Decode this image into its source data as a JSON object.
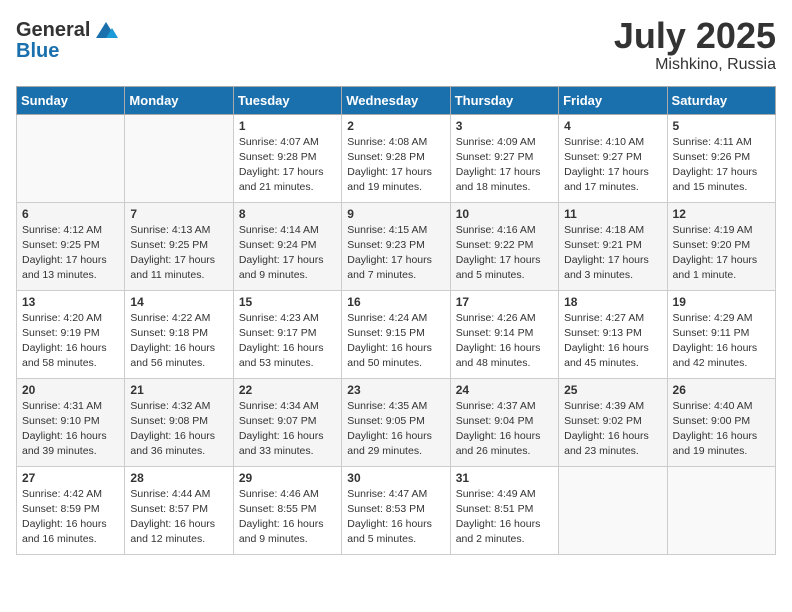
{
  "header": {
    "logo_general": "General",
    "logo_blue": "Blue",
    "month": "July 2025",
    "location": "Mishkino, Russia"
  },
  "columns": [
    "Sunday",
    "Monday",
    "Tuesday",
    "Wednesday",
    "Thursday",
    "Friday",
    "Saturday"
  ],
  "rows": [
    [
      {
        "day": "",
        "info": ""
      },
      {
        "day": "",
        "info": ""
      },
      {
        "day": "1",
        "info": "Sunrise: 4:07 AM\nSunset: 9:28 PM\nDaylight: 17 hours and 21 minutes."
      },
      {
        "day": "2",
        "info": "Sunrise: 4:08 AM\nSunset: 9:28 PM\nDaylight: 17 hours and 19 minutes."
      },
      {
        "day": "3",
        "info": "Sunrise: 4:09 AM\nSunset: 9:27 PM\nDaylight: 17 hours and 18 minutes."
      },
      {
        "day": "4",
        "info": "Sunrise: 4:10 AM\nSunset: 9:27 PM\nDaylight: 17 hours and 17 minutes."
      },
      {
        "day": "5",
        "info": "Sunrise: 4:11 AM\nSunset: 9:26 PM\nDaylight: 17 hours and 15 minutes."
      }
    ],
    [
      {
        "day": "6",
        "info": "Sunrise: 4:12 AM\nSunset: 9:25 PM\nDaylight: 17 hours and 13 minutes."
      },
      {
        "day": "7",
        "info": "Sunrise: 4:13 AM\nSunset: 9:25 PM\nDaylight: 17 hours and 11 minutes."
      },
      {
        "day": "8",
        "info": "Sunrise: 4:14 AM\nSunset: 9:24 PM\nDaylight: 17 hours and 9 minutes."
      },
      {
        "day": "9",
        "info": "Sunrise: 4:15 AM\nSunset: 9:23 PM\nDaylight: 17 hours and 7 minutes."
      },
      {
        "day": "10",
        "info": "Sunrise: 4:16 AM\nSunset: 9:22 PM\nDaylight: 17 hours and 5 minutes."
      },
      {
        "day": "11",
        "info": "Sunrise: 4:18 AM\nSunset: 9:21 PM\nDaylight: 17 hours and 3 minutes."
      },
      {
        "day": "12",
        "info": "Sunrise: 4:19 AM\nSunset: 9:20 PM\nDaylight: 17 hours and 1 minute."
      }
    ],
    [
      {
        "day": "13",
        "info": "Sunrise: 4:20 AM\nSunset: 9:19 PM\nDaylight: 16 hours and 58 minutes."
      },
      {
        "day": "14",
        "info": "Sunrise: 4:22 AM\nSunset: 9:18 PM\nDaylight: 16 hours and 56 minutes."
      },
      {
        "day": "15",
        "info": "Sunrise: 4:23 AM\nSunset: 9:17 PM\nDaylight: 16 hours and 53 minutes."
      },
      {
        "day": "16",
        "info": "Sunrise: 4:24 AM\nSunset: 9:15 PM\nDaylight: 16 hours and 50 minutes."
      },
      {
        "day": "17",
        "info": "Sunrise: 4:26 AM\nSunset: 9:14 PM\nDaylight: 16 hours and 48 minutes."
      },
      {
        "day": "18",
        "info": "Sunrise: 4:27 AM\nSunset: 9:13 PM\nDaylight: 16 hours and 45 minutes."
      },
      {
        "day": "19",
        "info": "Sunrise: 4:29 AM\nSunset: 9:11 PM\nDaylight: 16 hours and 42 minutes."
      }
    ],
    [
      {
        "day": "20",
        "info": "Sunrise: 4:31 AM\nSunset: 9:10 PM\nDaylight: 16 hours and 39 minutes."
      },
      {
        "day": "21",
        "info": "Sunrise: 4:32 AM\nSunset: 9:08 PM\nDaylight: 16 hours and 36 minutes."
      },
      {
        "day": "22",
        "info": "Sunrise: 4:34 AM\nSunset: 9:07 PM\nDaylight: 16 hours and 33 minutes."
      },
      {
        "day": "23",
        "info": "Sunrise: 4:35 AM\nSunset: 9:05 PM\nDaylight: 16 hours and 29 minutes."
      },
      {
        "day": "24",
        "info": "Sunrise: 4:37 AM\nSunset: 9:04 PM\nDaylight: 16 hours and 26 minutes."
      },
      {
        "day": "25",
        "info": "Sunrise: 4:39 AM\nSunset: 9:02 PM\nDaylight: 16 hours and 23 minutes."
      },
      {
        "day": "26",
        "info": "Sunrise: 4:40 AM\nSunset: 9:00 PM\nDaylight: 16 hours and 19 minutes."
      }
    ],
    [
      {
        "day": "27",
        "info": "Sunrise: 4:42 AM\nSunset: 8:59 PM\nDaylight: 16 hours and 16 minutes."
      },
      {
        "day": "28",
        "info": "Sunrise: 4:44 AM\nSunset: 8:57 PM\nDaylight: 16 hours and 12 minutes."
      },
      {
        "day": "29",
        "info": "Sunrise: 4:46 AM\nSunset: 8:55 PM\nDaylight: 16 hours and 9 minutes."
      },
      {
        "day": "30",
        "info": "Sunrise: 4:47 AM\nSunset: 8:53 PM\nDaylight: 16 hours and 5 minutes."
      },
      {
        "day": "31",
        "info": "Sunrise: 4:49 AM\nSunset: 8:51 PM\nDaylight: 16 hours and 2 minutes."
      },
      {
        "day": "",
        "info": ""
      },
      {
        "day": "",
        "info": ""
      }
    ]
  ]
}
